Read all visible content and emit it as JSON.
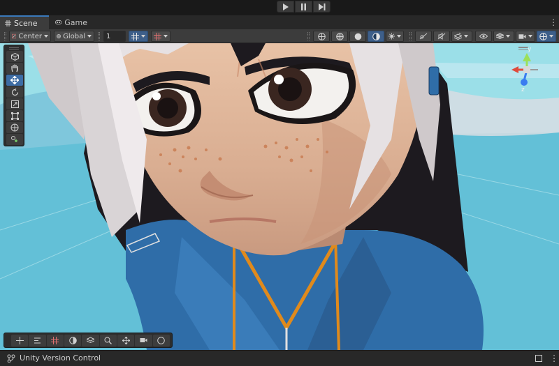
{
  "playbar": {
    "buttons": [
      "play-icon",
      "pause-icon",
      "step-icon"
    ]
  },
  "tabs": {
    "scene_label": "Scene",
    "game_label": "Game",
    "menu_icon": "kebab-menu-icon"
  },
  "toolbar": {
    "pivot_label": "Center",
    "space_label": "Global",
    "grid_snap_value": "1"
  },
  "tools": {
    "items": [
      "view-tool-icon",
      "hand-tool-icon",
      "move-tool-icon",
      "rotate-tool-icon",
      "scale-tool-icon",
      "rect-tool-icon",
      "transform-tool-icon",
      "custom-tool-icon"
    ],
    "active": "move-tool-icon"
  },
  "gizmo": {
    "y_axis": "y",
    "z_axis": "z"
  },
  "status": {
    "label": "Unity Version Control"
  },
  "colors": {
    "accent": "#3a79bb",
    "active_button": "#3e5f8a",
    "panel": "#3c3c3c"
  }
}
